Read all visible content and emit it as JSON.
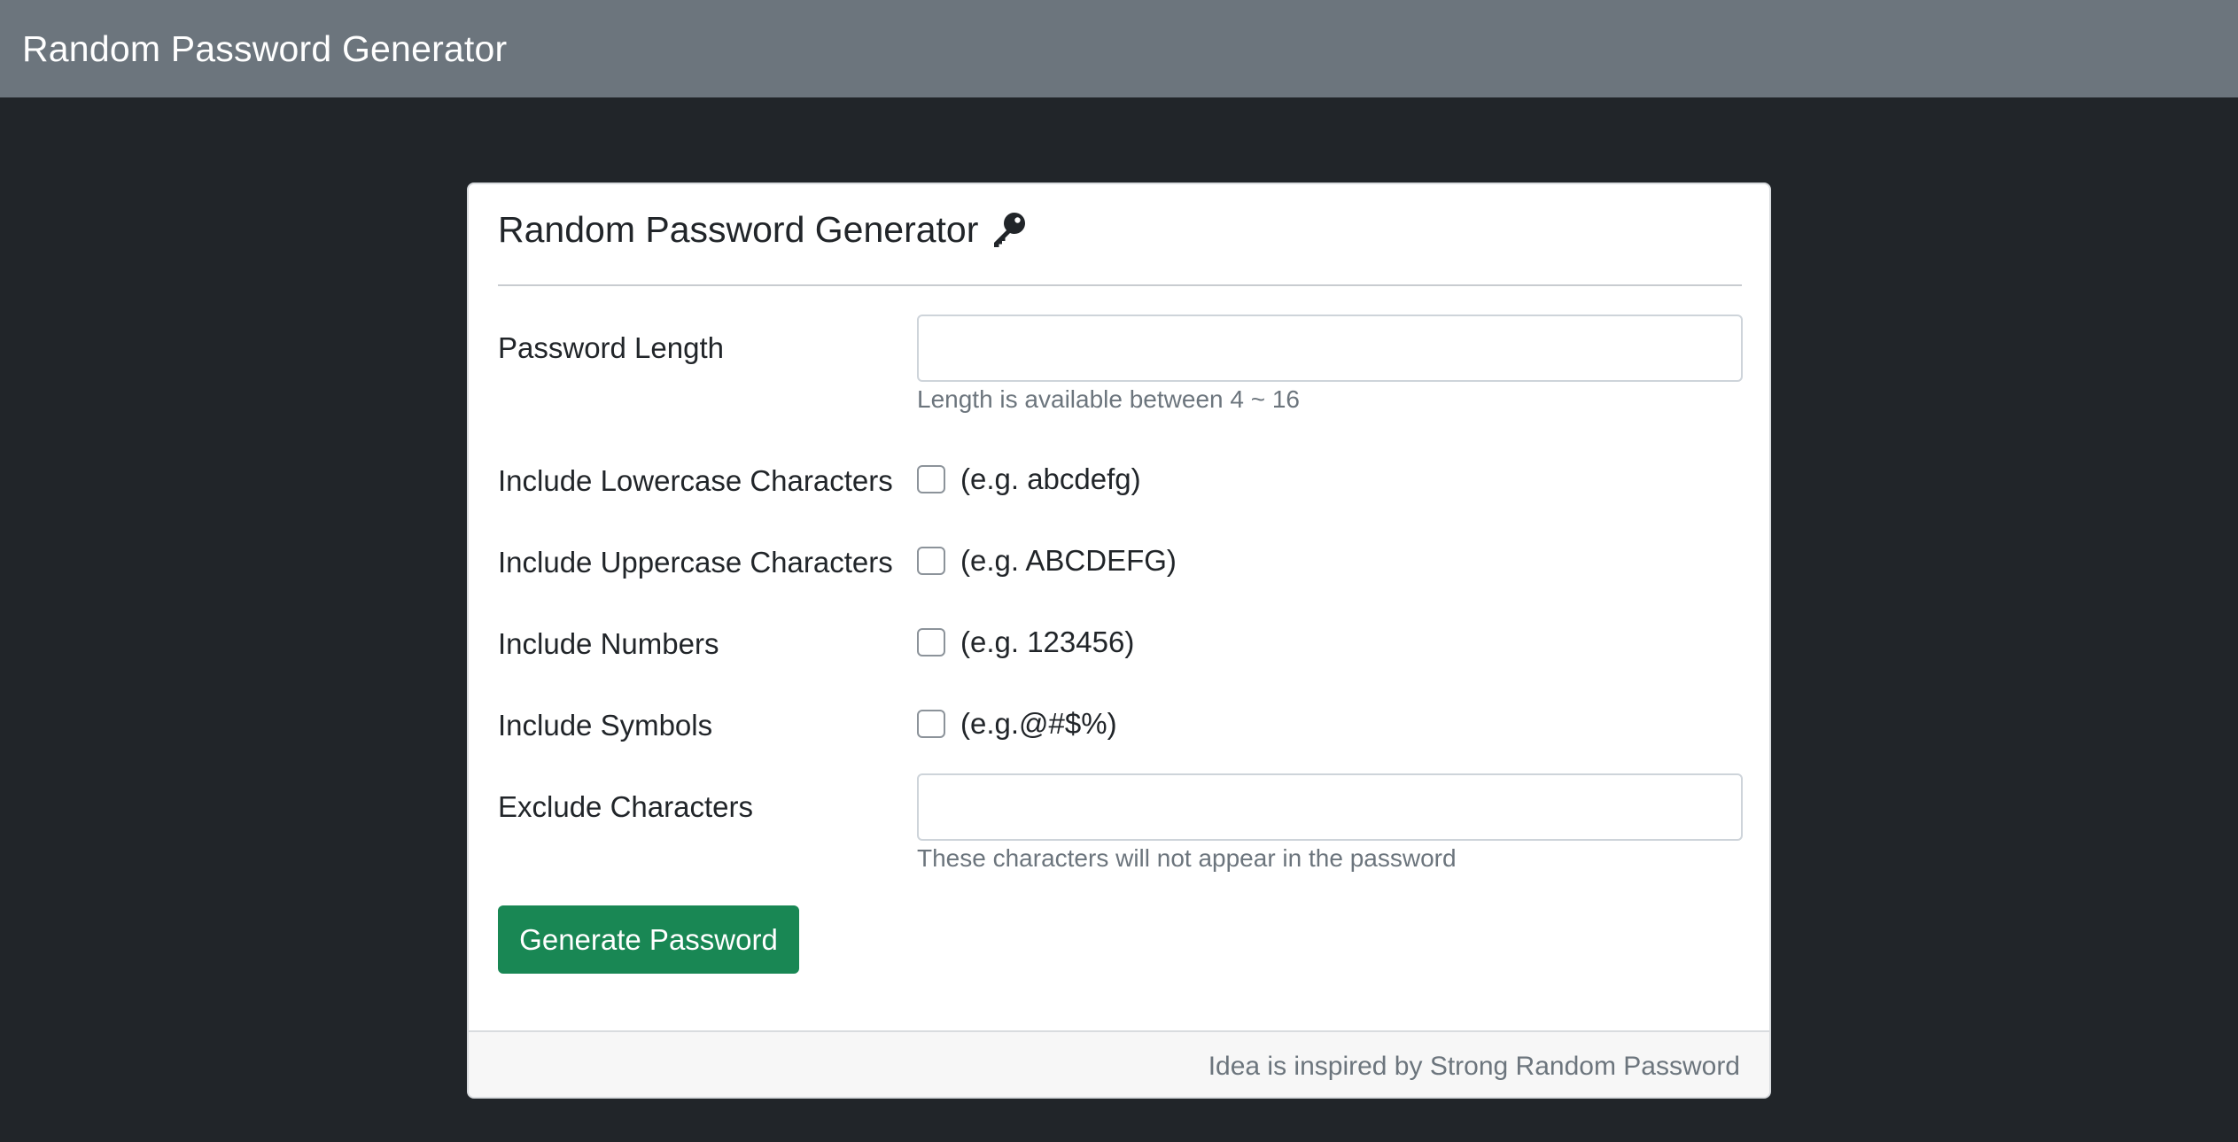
{
  "navbar": {
    "brand": "Random Password Generator"
  },
  "card": {
    "title": "Random Password Generator",
    "title_icon": "key-icon",
    "fields": {
      "length": {
        "label": "Password Length",
        "value": "",
        "placeholder": "",
        "help": "Length is available between 4 ~ 16"
      },
      "lowercase": {
        "label": "Include Lowercase Characters",
        "example": "(e.g. abcdefg)",
        "checked": false
      },
      "uppercase": {
        "label": "Include Uppercase Characters",
        "example": "(e.g. ABCDEFG)",
        "checked": false
      },
      "numbers": {
        "label": "Include Numbers",
        "example": "(e.g. 123456)",
        "checked": false
      },
      "symbols": {
        "label": "Include Symbols",
        "example": "(e.g.@#$%)",
        "checked": false
      },
      "exclude": {
        "label": "Exclude Characters",
        "value": "",
        "placeholder": "",
        "help": "These characters will not appear in the password"
      }
    },
    "generate_button": "Generate Password",
    "footer": "Idea is inspired by Strong Random Password"
  },
  "colors": {
    "navbar_bg": "#6c757d",
    "page_bg": "#212529",
    "button_success": "#198754",
    "muted_text": "#6c757d"
  }
}
